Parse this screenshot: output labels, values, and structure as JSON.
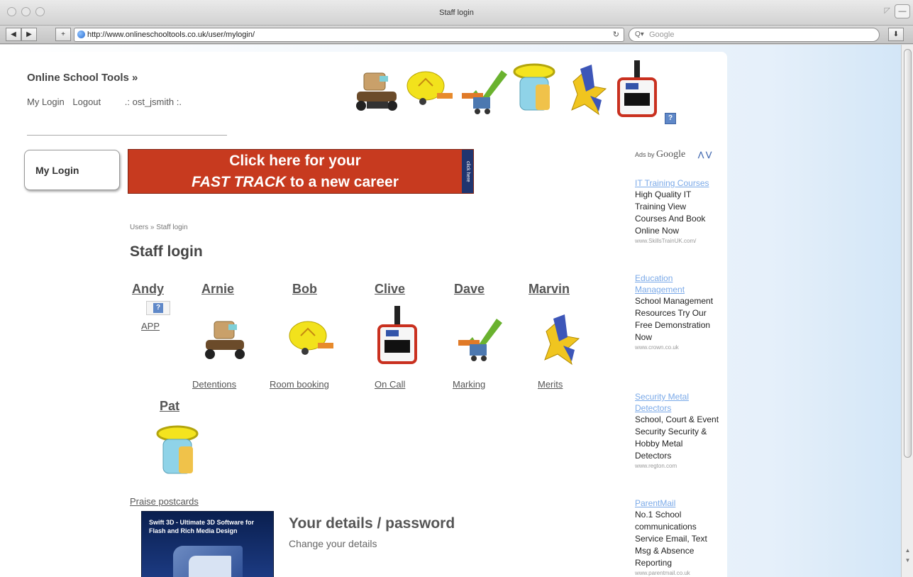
{
  "browser": {
    "window_title": "Staff login",
    "url": "http://www.onlineschooltools.co.uk/user/mylogin/",
    "search_placeholder": "Google",
    "nav_back": "◀",
    "nav_forward": "▶",
    "nav_add": "+"
  },
  "site": {
    "title": "Online School Tools »",
    "links": [
      "My Login",
      "Logout",
      ".: ost_jsmith :."
    ],
    "help_icon_label": "?"
  },
  "sidebar": {
    "mylogin_label": "My Login"
  },
  "banner": {
    "line1": "Click here for your",
    "line2_italic": "FAST TRACK",
    "line2_rest": " to a new career",
    "strip_text": "click here"
  },
  "content": {
    "breadcrumb": "Users » Staff login",
    "title": "Staff login",
    "apps": [
      {
        "name": "Andy",
        "link": "APP"
      },
      {
        "name": "Arnie",
        "link": "Detentions"
      },
      {
        "name": "Bob",
        "link": "Room booking"
      },
      {
        "name": "Clive",
        "link": "On Call"
      },
      {
        "name": "Dave",
        "link": "Marking"
      },
      {
        "name": "Marvin",
        "link": "Merits"
      },
      {
        "name": "Pat",
        "link": "Praise postcards"
      }
    ],
    "details_title": "Your details / password",
    "details_sub": "Change your details",
    "promo_text": "Swift 3D - Ultimate 3D Software for Flash and Rich Media Design"
  },
  "ads": {
    "label_prefix": "Ads by",
    "label_brand": "Google",
    "items": [
      {
        "title": "IT Training Courses",
        "body": "High Quality IT Training View Courses And Book Online Now",
        "url": "www.SkillsTrainUK.com/"
      },
      {
        "title": "Education Management",
        "body": "School Management Resources Try Our Free Demonstration Now",
        "url": "www.crown.co.uk"
      },
      {
        "title": "Security Metal Detectors",
        "body": "School, Court & Event Security Security & Hobby Metal Detectors",
        "url": "www.regton.com"
      },
      {
        "title": "ParentMail",
        "body": "No.1 School communications Service Email, Text Msg & Absence Reporting",
        "url": "www.parentmail.co.uk"
      }
    ]
  },
  "colors": {
    "banner_red": "#c73a1f",
    "ad_link": "#7aa9e8",
    "help_blue": "#5f88c8"
  }
}
